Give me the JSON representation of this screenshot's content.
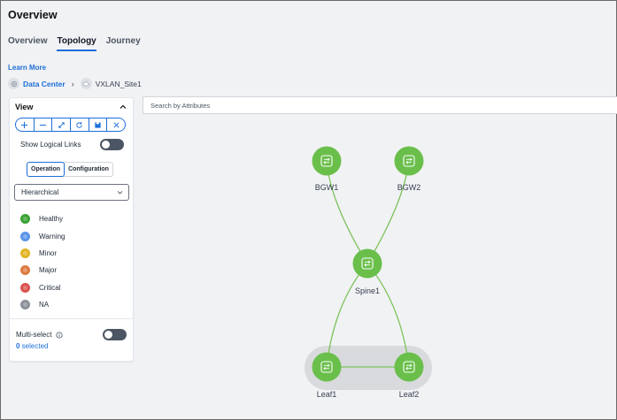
{
  "page": {
    "title": "Overview"
  },
  "tabs": [
    {
      "label": "Overview",
      "active": false
    },
    {
      "label": "Topology",
      "active": true
    },
    {
      "label": "Journey",
      "active": false
    }
  ],
  "learn_more": "Learn More",
  "breadcrumb": {
    "items": [
      {
        "label": "Data Center",
        "icon": "globe-icon",
        "link": true
      },
      {
        "label": "VXLAN_Site1",
        "icon": "cloud-icon",
        "link": false
      }
    ],
    "separator": "›"
  },
  "view_panel": {
    "title": "View",
    "toolbar": [
      {
        "icon": "zoom-in-icon",
        "glyph": "+"
      },
      {
        "icon": "zoom-out-icon",
        "glyph": "−"
      },
      {
        "icon": "fit-to-screen-icon",
        "glyph": "↗"
      },
      {
        "icon": "refresh-icon",
        "glyph": "↻"
      },
      {
        "icon": "save-icon",
        "glyph": "▣"
      },
      {
        "icon": "close-icon",
        "glyph": "×"
      }
    ],
    "show_logical_links": {
      "label": "Show Logical Links",
      "enabled": false
    },
    "mode_tabs": {
      "operation": "Operation",
      "configuration": "Configuration",
      "active": "operation"
    },
    "layout_select": {
      "value": "Hierarchical"
    },
    "legend": [
      {
        "label": "Healthy",
        "color": "#3aa335"
      },
      {
        "label": "Warning",
        "color": "#5b95e8"
      },
      {
        "label": "Minor",
        "color": "#e2b424"
      },
      {
        "label": "Major",
        "color": "#dd7a3f"
      },
      {
        "label": "Critical",
        "color": "#d9534f"
      },
      {
        "label": "NA",
        "color": "#8b9099"
      }
    ],
    "multi_select": {
      "label": "Multi-select",
      "enabled": false
    },
    "selected": {
      "count": "0",
      "suffix": " selected"
    }
  },
  "search": {
    "placeholder": "Search by Attributes"
  },
  "topology": {
    "node_color": "#6abf4b",
    "link_color": "#7cc25a",
    "group_color": "#d9dadd",
    "nodes": [
      {
        "id": "bgw1",
        "label": "BGW1"
      },
      {
        "id": "bgw2",
        "label": "BGW2"
      },
      {
        "id": "spine1",
        "label": "Spine1"
      },
      {
        "id": "leaf1",
        "label": "Leaf1"
      },
      {
        "id": "leaf2",
        "label": "Leaf2"
      }
    ],
    "links": [
      {
        "from": "bgw1",
        "to": "spine1"
      },
      {
        "from": "bgw2",
        "to": "spine1"
      },
      {
        "from": "spine1",
        "to": "leaf1"
      },
      {
        "from": "spine1",
        "to": "leaf2"
      },
      {
        "from": "leaf1",
        "to": "leaf2"
      }
    ]
  }
}
